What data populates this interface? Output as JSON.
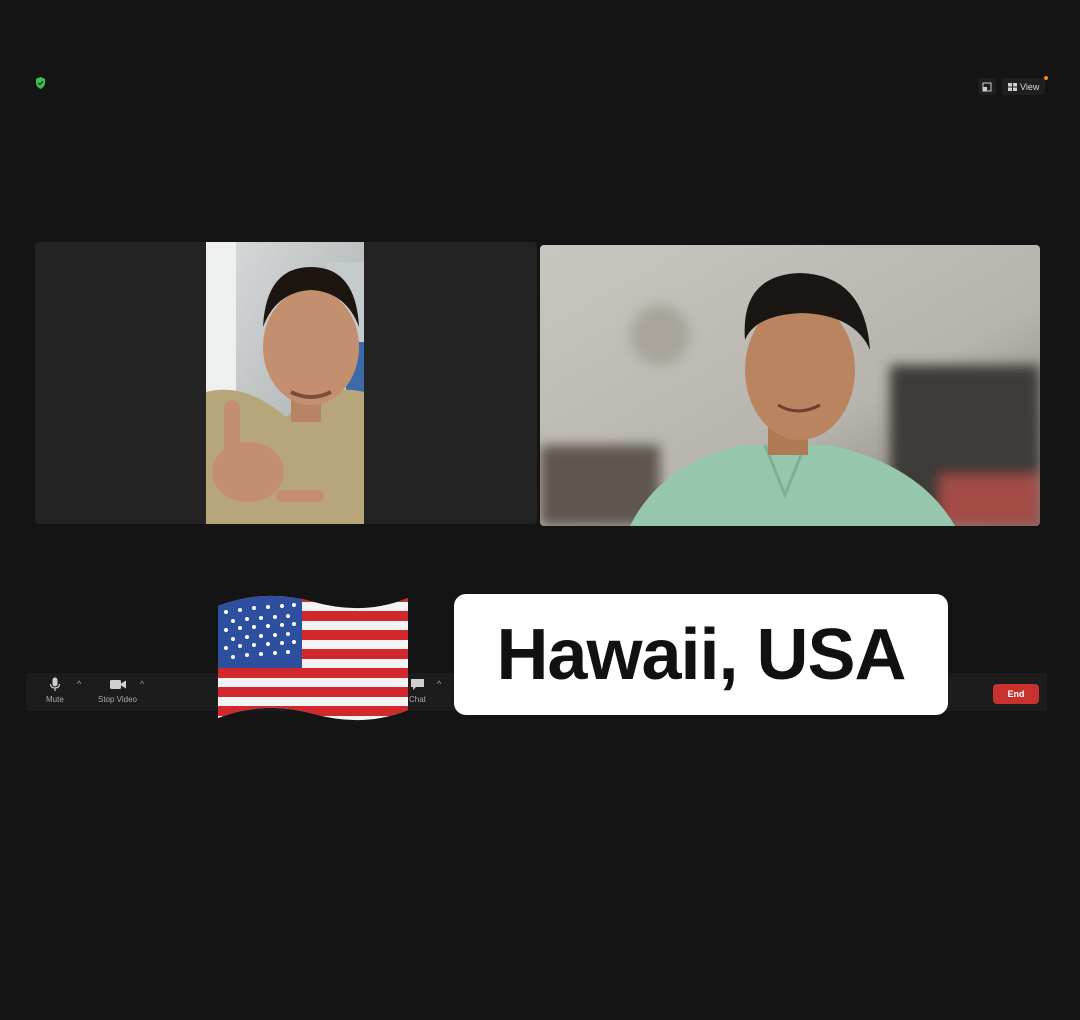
{
  "top_bar": {
    "security_icon": "shield-check-icon",
    "security_color": "#3fbf4f",
    "view_label": "View",
    "notification_dot_color": "#f08a24"
  },
  "video_tiles": [
    {
      "participant": "left",
      "media": "video-feed-portrait"
    },
    {
      "participant": "right",
      "media": "video-feed-landscape"
    }
  ],
  "toolbar": {
    "mute_label": "Mute",
    "stop_video_label": "Stop Video",
    "chat_label": "Chat",
    "end_label": "End",
    "end_color": "#c8322e"
  },
  "overlay": {
    "flag_icon": "us-flag-icon",
    "location_text": "Hawaii, USA"
  }
}
